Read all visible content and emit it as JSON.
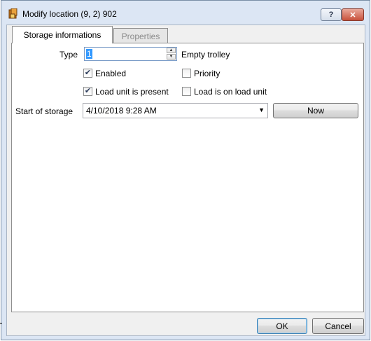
{
  "window": {
    "title": "Modify location (9, 2) 902",
    "help_label": "?",
    "close_label": "✕"
  },
  "tabs": [
    {
      "label": "Storage informations",
      "active": true
    },
    {
      "label": "Properties",
      "active": false
    }
  ],
  "form": {
    "type_label": "Type",
    "type_value": "1",
    "type_description": "Empty trolley",
    "enabled": {
      "label": "Enabled",
      "checked": true
    },
    "priority": {
      "label": "Priority",
      "checked": false
    },
    "load_unit_present": {
      "label": "Load unit is present",
      "checked": true
    },
    "load_is_on_load_unit": {
      "label": "Load is on load unit",
      "checked": false
    },
    "start_of_storage_label": "Start of storage",
    "start_of_storage_value": "4/10/2018 9:28 AM",
    "now_label": "Now"
  },
  "footer": {
    "ok_label": "OK",
    "cancel_label": "Cancel"
  },
  "icons": {
    "app": "app-icon",
    "check": "✔",
    "dropdown": "▼",
    "spin_up": "▲",
    "spin_down": "▼"
  },
  "colors": {
    "frame": "#dce6f4",
    "selection": "#3399ff"
  }
}
